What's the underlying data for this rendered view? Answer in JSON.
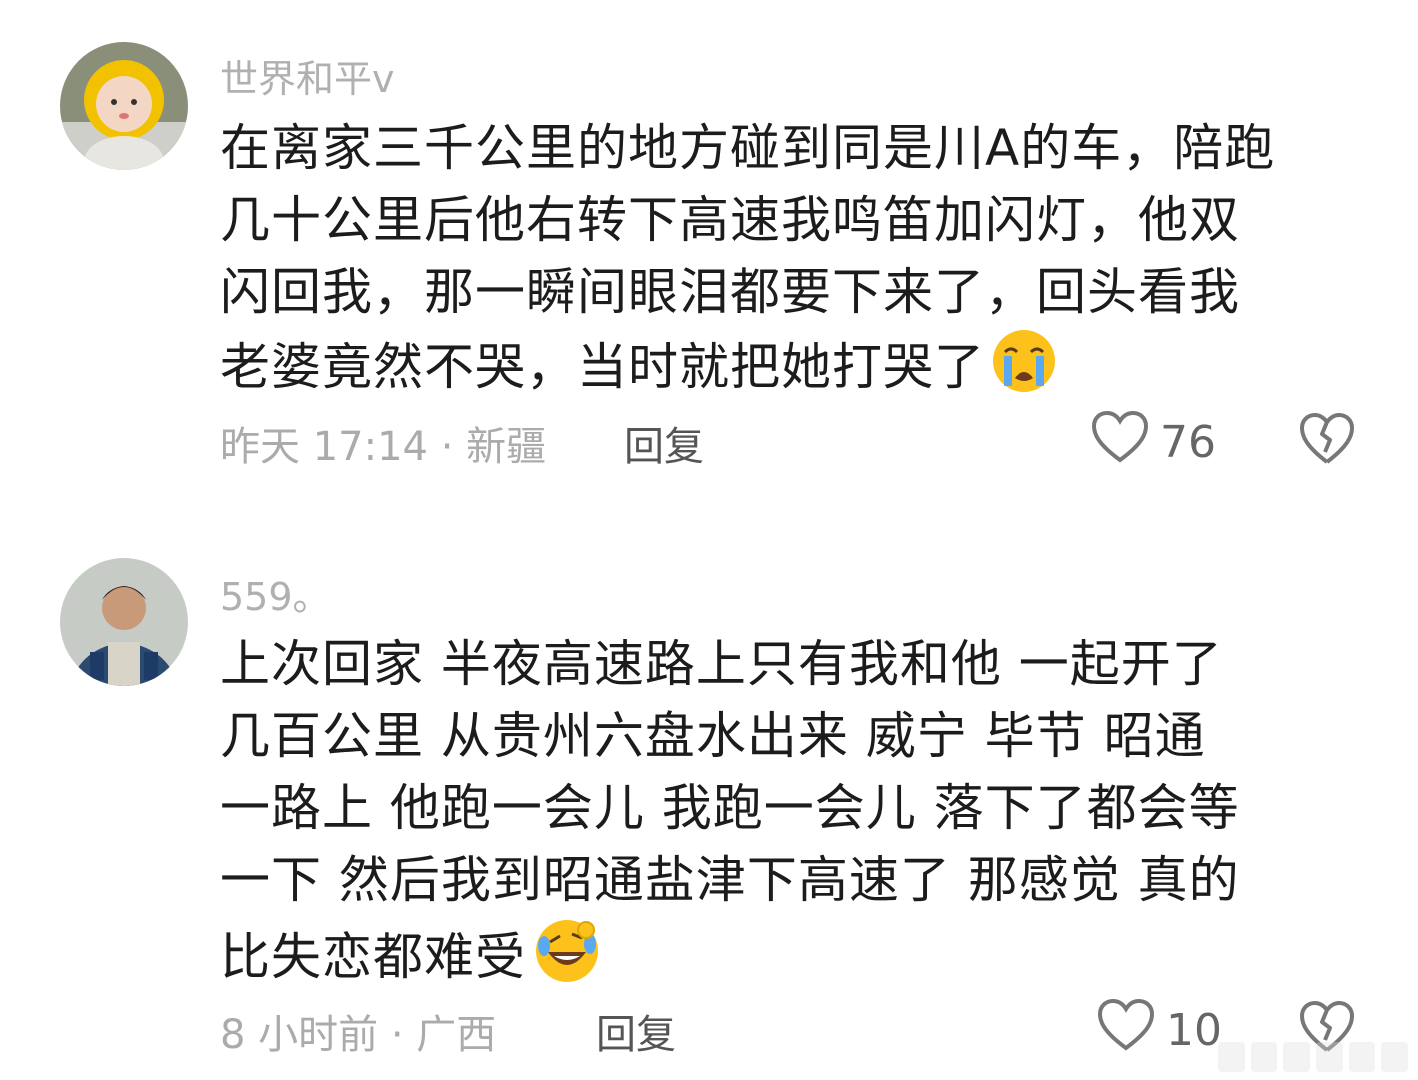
{
  "comments": [
    {
      "username": "世界和平v",
      "content_lines": [
        "在离家三千公里的地方碰到同是川A的车，陪跑",
        "几十公里后他右转下高速我鸣笛加闪灯，他双",
        "闪回我，那一瞬间眼泪都要下来了，回头看我",
        "老婆竟然不哭，当时就把她打哭了"
      ],
      "emoji": "loudly-crying-face",
      "meta": "昨天 17:14 · 新疆",
      "reply_label": "回复",
      "like_count": "76"
    },
    {
      "username": "559。",
      "content_lines": [
        "上次回家  半夜高速路上只有我和他  一起开了",
        "几百公里  从贵州六盘水出来  威宁  毕节 昭通",
        "一路上  他跑一会儿  我跑一会儿  落下了都会等",
        "一下  然后我到昭通盐津下高速了  那感觉 真的",
        "比失恋都难受"
      ],
      "emoji": "rolling-on-floor-laughing",
      "meta": "8 小时前 · 广西",
      "reply_label": "回复",
      "like_count": "10"
    }
  ]
}
